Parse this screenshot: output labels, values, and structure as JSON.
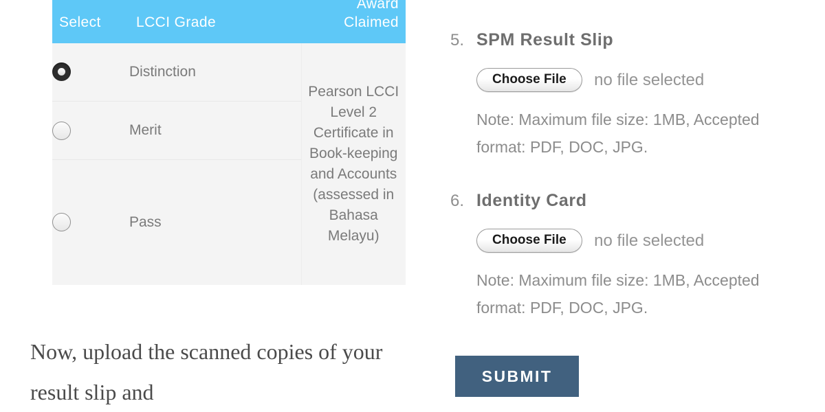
{
  "grade_table": {
    "headers": {
      "select": "Select",
      "grade": "LCCI Grade",
      "award": "Award Claimed"
    },
    "header_bg": "#5ec8f7",
    "rows": [
      {
        "grade": "Distinction",
        "selected": true
      },
      {
        "grade": "Merit",
        "selected": false
      },
      {
        "grade": "Pass",
        "selected": false
      }
    ],
    "award_claimed": "Pearson LCCI Level 2 Certificate in Book-keeping and Accounts (assessed in Bahasa Melayu)"
  },
  "scan_note": "Now, upload the scanned copies of your result slip and",
  "upload_steps": [
    {
      "number": "5.",
      "title": "SPM Result Slip",
      "button_label": "Choose File",
      "file_status": "no file selected",
      "note": "Note: Maximum file size: 1MB, Accepted format: PDF, DOC, JPG."
    },
    {
      "number": "6.",
      "title": "Identity Card",
      "button_label": "Choose File",
      "file_status": "no file selected",
      "note": "Note: Maximum file size: 1MB, Accepted format: PDF, DOC, JPG."
    }
  ],
  "submit": {
    "label": "SUBMIT",
    "color": "#41617f"
  }
}
